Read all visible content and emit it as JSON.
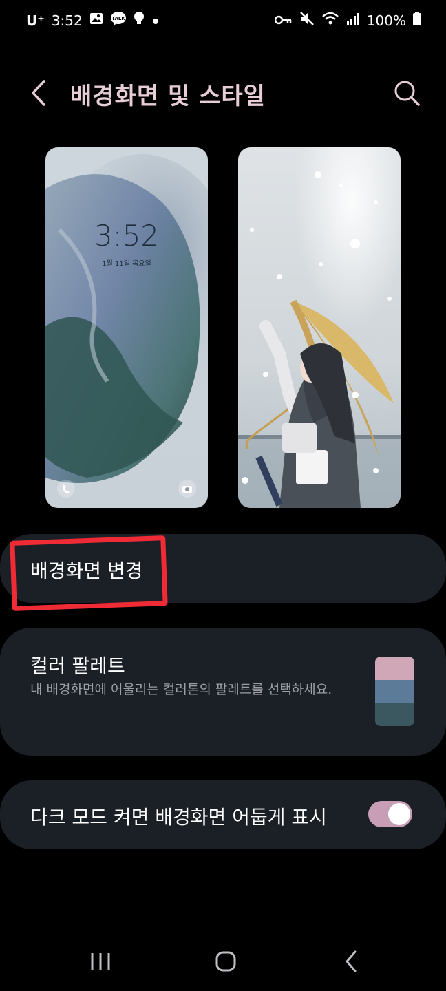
{
  "status_bar": {
    "carrier": "U⁺",
    "time": "3:52",
    "battery": "100%",
    "left_icons": [
      "image-icon",
      "talk-icon",
      "bulb-icon",
      "dot-icon"
    ],
    "right_icons": [
      "key-icon",
      "mute-icon",
      "wifi-icon",
      "signal-icon",
      "battery-icon"
    ]
  },
  "header": {
    "title": "배경화면 및 스타일",
    "back_icon": "back-arrow-icon",
    "search_icon": "search-icon"
  },
  "previews": {
    "lock": {
      "time": "3:52",
      "date": "1월 11일 목요일"
    },
    "home": {}
  },
  "wallpaper_change": {
    "label": "배경화면 변경"
  },
  "color_palette": {
    "title": "컬러 팔레트",
    "description": "내 배경화면에 어울리는 컬러톤의 팔레트를 선택하세요.",
    "colors": [
      "#cfa7b7",
      "#5b7b99",
      "#3b5861"
    ]
  },
  "dark_mode_dim": {
    "label": "다크 모드 켜면 배경화면 어둡게 표시",
    "enabled": true
  },
  "colors": {
    "accent": "#c79eb5",
    "title": "#e6cdd6",
    "card": "#1b1f26",
    "highlight": "#ef2b36"
  },
  "nav_bar": {
    "icons": [
      "recent-apps-icon",
      "home-icon",
      "back-icon"
    ]
  }
}
